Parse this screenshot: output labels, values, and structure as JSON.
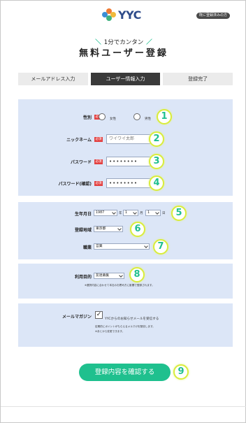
{
  "header": {
    "logo_text": "YYC",
    "login_link": "既に登録済みの方",
    "brand_color": "#2f4c8a"
  },
  "hero": {
    "tagline": "1分でカンタン",
    "tagline_slash_left": "＼",
    "tagline_slash_right": "／",
    "title": "無料ユーザー登録"
  },
  "steps": [
    {
      "label": "メールアドレス入力",
      "active": false
    },
    {
      "label": "ユーザー情報入力",
      "active": true
    },
    {
      "label": "登録完了",
      "active": false
    }
  ],
  "required_label": "必須",
  "form": {
    "gender": {
      "label": "性別",
      "options": [
        "女性",
        "男性"
      ],
      "badge": "1"
    },
    "nickname": {
      "label": "ニックネーム",
      "value": "ワイワイ太郎",
      "badge": "2"
    },
    "password": {
      "label": "パスワード",
      "value": "••••••••",
      "badge": "3"
    },
    "password_confirm": {
      "label": "パスワード(確認)",
      "value": "••••••••",
      "badge": "4"
    },
    "birthday": {
      "label": "生年月日",
      "year": "1987",
      "year_unit": "年",
      "month": "1",
      "month_unit": "月",
      "day": "1",
      "day_unit": "日",
      "badge": "5"
    },
    "region": {
      "label": "登録地域",
      "value": "東京都",
      "badge": "6"
    },
    "occupation": {
      "label": "職業",
      "value": "営業",
      "badge": "7"
    },
    "purpose": {
      "label": "利用目的",
      "value": "友達募集",
      "note": "※選択内容に合わせて本社のお薦め方に影響で登録されます。",
      "badge": "8"
    },
    "magazine": {
      "label": "メールマガジン",
      "checkbox_text": "YYCからのお知らせメールを受信する",
      "checked": true,
      "note_line1": "定期的にポイントがもらえるメルマガを配信します。",
      "note_line2": "※あとから変更できます。"
    }
  },
  "submit": {
    "label": "登録内容を確認する",
    "badge": "9"
  },
  "colors": {
    "accent_green": "#1fc08e",
    "panel_blue": "#dce6f7",
    "required_red": "#e34040",
    "badge_ring": "#d9ec3b"
  }
}
